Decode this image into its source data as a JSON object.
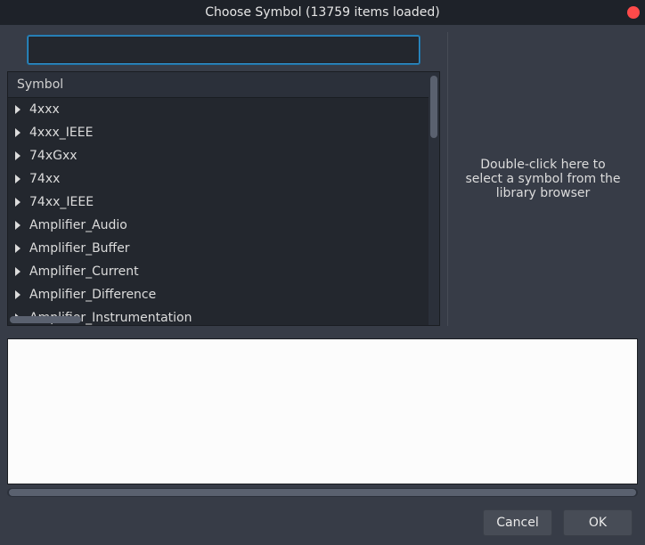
{
  "window": {
    "title": "Choose Symbol (13759 items loaded)",
    "close_color": "#ff4a4a"
  },
  "search": {
    "value": "",
    "placeholder": ""
  },
  "tree": {
    "header": "Symbol",
    "items": [
      {
        "label": "4xxx"
      },
      {
        "label": "4xxx_IEEE"
      },
      {
        "label": "74xGxx"
      },
      {
        "label": "74xx"
      },
      {
        "label": "74xx_IEEE"
      },
      {
        "label": "Amplifier_Audio"
      },
      {
        "label": "Amplifier_Buffer"
      },
      {
        "label": "Amplifier_Current"
      },
      {
        "label": "Amplifier_Difference"
      },
      {
        "label": "Amplifier_Instrumentation"
      }
    ]
  },
  "preview": {
    "hint": "Double-click here to select a symbol from the library browser"
  },
  "footer": {
    "cancel": "Cancel",
    "ok": "OK"
  }
}
